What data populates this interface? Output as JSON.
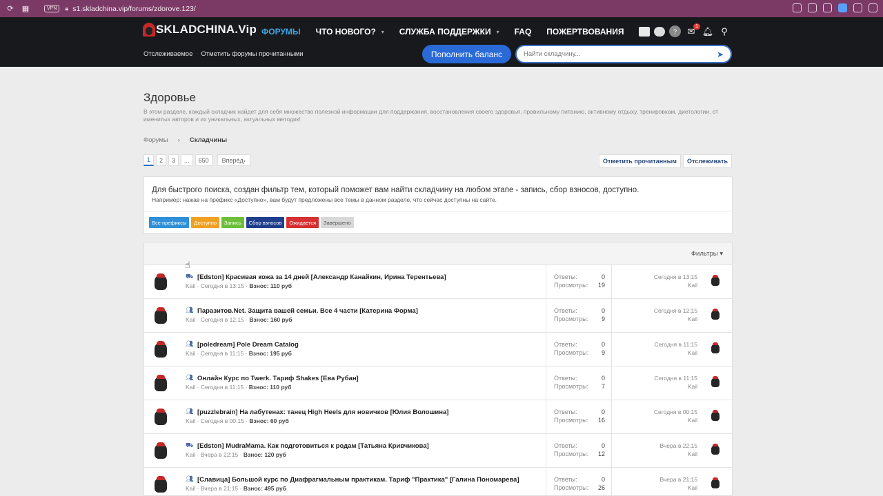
{
  "browser": {
    "vpn": "VPN",
    "url": "s1.skladchina.vip/forums/zdorove.123/"
  },
  "header": {
    "logo": "SKLADCHINA.Vip",
    "nav": [
      {
        "label": "ФОРУМЫ",
        "active": true,
        "caret": false
      },
      {
        "label": "ЧТО НОВОГО?",
        "active": false,
        "caret": true
      },
      {
        "label": "СЛУЖБА ПОДДЕРЖКИ",
        "active": false,
        "caret": true
      },
      {
        "label": "FAQ",
        "active": false,
        "caret": false
      },
      {
        "label": "ПОЖЕРТВОВАНИЯ",
        "active": false,
        "caret": false
      }
    ],
    "inbox_badge": "1",
    "subnav": [
      "Отслеживаемое",
      "Отметить форумы прочитанными"
    ],
    "topup_label": "Пополнить баланс",
    "search_placeholder": "Найти складчину..."
  },
  "page": {
    "title": "Здоровье",
    "description": "В этом разделе, каждый складчик найдет для себя множество полезной информации для поддержания, восстановления своего здоровья, правильному питанию, активному отдыху, тренировкам, диетологии, от именитых авторов и их уникальных, актуальных методик!",
    "breadcrumb": [
      "Форумы",
      "Складчины"
    ],
    "pagination": [
      "1",
      "2",
      "3",
      "...",
      "650"
    ],
    "next_label": "Вперёд",
    "mark_read_label": "Отметить прочитанным",
    "watch_label": "Отслеживать"
  },
  "notice": {
    "main": "Для быстрого поиска, создан фильтр тем, который поможет вам найти складчину на любом этапе - запись, сбор взносов, доступно.",
    "sub": "Например: нажав на префикс «Доступно», вам будут предложены все темы в данном разделе, что сейчас доступны на сайте.",
    "prefixes": [
      {
        "label": "Все префиксы",
        "color": "#2f8fd8"
      },
      {
        "label": "Доступно",
        "color": "#f0a020"
      },
      {
        "label": "Запись",
        "color": "#6dbf3a"
      },
      {
        "label": "Сбор взносов",
        "color": "#1f3f8c"
      },
      {
        "label": "Ожидается",
        "color": "#d63030"
      },
      {
        "label": "Завершено",
        "color": "#d8d8d8"
      }
    ]
  },
  "threads": {
    "filters_label": "Фильтры",
    "replies_label": "Ответы:",
    "views_label": "Просмотры:",
    "rows": [
      {
        "icon": "basket",
        "title": "[Edston] Красивая кожа за 14 дней [Александр Канайкин, Ирина Терентьева]",
        "author": "Kail",
        "date": "Сегодня в 13:15",
        "fee": "Взнос: 110 руб",
        "replies": "0",
        "views": "19",
        "last_date": "Сегодня в 13:15",
        "last_user": "Kail"
      },
      {
        "icon": "group",
        "title": "Паразитов.Net. Защита вашей семьи. Все 4 части [Катерина Форма]",
        "author": "Kail",
        "date": "Сегодня в 12:15",
        "fee": "Взнос: 160 руб",
        "replies": "0",
        "views": "9",
        "last_date": "Сегодня в 12:15",
        "last_user": "Kail"
      },
      {
        "icon": "group",
        "title": "[poledream] Pole Dream Catalog",
        "author": "Kail",
        "date": "Сегодня в 11:15",
        "fee": "Взнос: 195 руб",
        "replies": "0",
        "views": "9",
        "last_date": "Сегодня в 11:15",
        "last_user": "Kail"
      },
      {
        "icon": "group",
        "title": "Онлайн Курс по Twerk. Тариф Shakes [Ева Рубан]",
        "author": "Kail",
        "date": "Сегодня в 11:15",
        "fee": "Взнос: 110 руб",
        "replies": "0",
        "views": "7",
        "last_date": "Сегодня в 11:15",
        "last_user": "Kail"
      },
      {
        "icon": "group",
        "title": "[puzzlebrain] На лабутенах: танец High Heels для новичков [Юлия Волошина]",
        "author": "Kail",
        "date": "Сегодня в 00:15",
        "fee": "Взнос: 60 руб",
        "replies": "0",
        "views": "16",
        "last_date": "Сегодня в 00:15",
        "last_user": "Kail"
      },
      {
        "icon": "basket",
        "title": "[Edston] MudraMama. Как подготовиться к родам [Татьяна Кривчикова]",
        "author": "Kail",
        "date": "Вчера в 22:15",
        "fee": "Взнос: 120 руб",
        "replies": "0",
        "views": "12",
        "last_date": "Вчера в 22:15",
        "last_user": "Kail"
      },
      {
        "icon": "group",
        "title": "[Славица] Большой курс по Диафрагмальным практикам. Тариф \"Практика\" [Галина Пономарева]",
        "author": "Kail",
        "date": "Вчера в 21:15",
        "fee": "Взнос: 495 руб",
        "replies": "0",
        "views": "26",
        "last_date": "Вчера в 21:15",
        "last_user": "Kail"
      }
    ]
  }
}
